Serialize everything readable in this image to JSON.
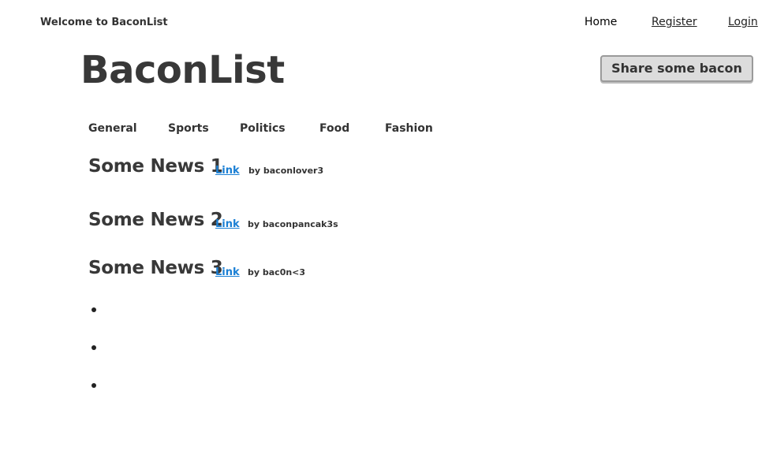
{
  "header": {
    "welcome": "Welcome to BaconList",
    "nav": {
      "home": "Home",
      "register": "Register",
      "login": "Login"
    }
  },
  "logo": "BaconList",
  "share_button": "Share some bacon",
  "categories": [
    "General",
    "Sports",
    "Politics",
    "Food",
    "Fashion"
  ],
  "news": [
    {
      "title": "Some News 1",
      "link": "Link",
      "by": "by baconlover3"
    },
    {
      "title": "Some News 2",
      "link": "Link",
      "by": "by baconpancak3s"
    },
    {
      "title": "Some News 3",
      "link": "Link",
      "by": "by bac0n<3"
    }
  ],
  "empty_list_items": 3,
  "colors": {
    "text": "#333333",
    "link": "#1a7fd4",
    "button_bg": "#dcdcdc",
    "button_border": "#9a9a9a"
  }
}
